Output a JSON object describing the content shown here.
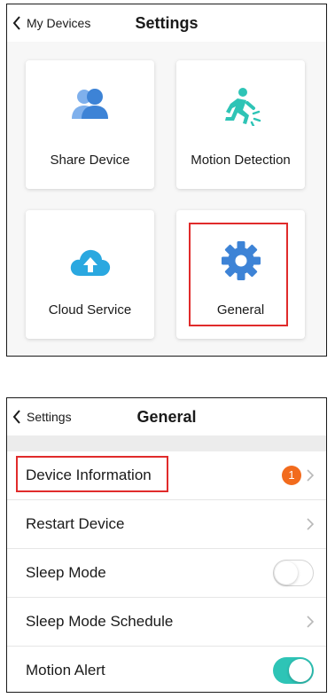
{
  "settings_screen": {
    "back_label": "My Devices",
    "title": "Settings",
    "tiles": [
      {
        "label": "Share Device",
        "icon": "share-device-icon",
        "color": "#3d83d6"
      },
      {
        "label": "Motion Detection",
        "icon": "motion-detection-icon",
        "color": "#2ec4b6"
      },
      {
        "label": "Cloud Service",
        "icon": "cloud-upload-icon",
        "color": "#2aa8e0"
      },
      {
        "label": "General",
        "icon": "gear-icon",
        "color": "#3d83d6"
      }
    ]
  },
  "general_screen": {
    "back_label": "Settings",
    "title": "General",
    "rows": [
      {
        "label": "Device Information",
        "badge": "1"
      },
      {
        "label": "Restart Device"
      },
      {
        "label": "Sleep Mode",
        "toggle": "off"
      },
      {
        "label": "Sleep Mode Schedule"
      },
      {
        "label": "Motion Alert",
        "toggle": "on"
      }
    ]
  },
  "colors": {
    "highlight": "#e02b2b",
    "badge": "#f26b1d",
    "toggle_on": "#2ec4b6"
  }
}
